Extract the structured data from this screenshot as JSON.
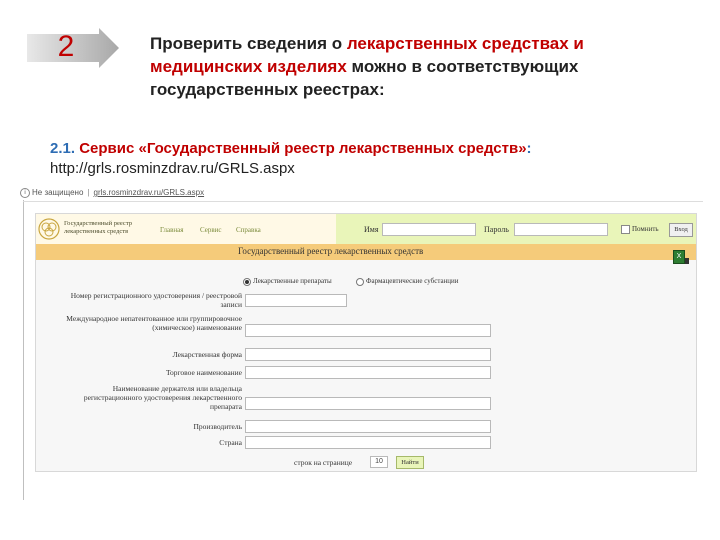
{
  "slide": {
    "step_number": "2",
    "headline_part1": "Проверить сведения о ",
    "headline_highlight": "лекарственных средствах и медицинских изделиях",
    "headline_part2": " можно в соответствующих государственных реестрах:",
    "service_number": "2.1.",
    "service_text": " Сервис «Государственный реестр лекарственных средств»",
    "service_colon": ":",
    "url": "http://grls.rosminzdrav.ru/GRLS.aspx"
  },
  "browser": {
    "security_label": "Не защищено",
    "address_url": "grls.rosminzdrav.ru/GRLS.aspx"
  },
  "site": {
    "logo_text": "Государственный реестр лекарственных средств",
    "nav": [
      "Главная",
      "Сервис",
      "Справка"
    ],
    "login_label": "Имя",
    "password_label": "Пароль",
    "remember_label": "Помнить",
    "login_button": "Вход",
    "title": "Государственный реестр лекарственных средств",
    "excel_icon": "excel-icon",
    "radio_options": [
      "Лекарственные препараты",
      "Фармацевтические субстанции"
    ],
    "fields": [
      "Номер регистрационного удостоверения / реестровой записи",
      "Международное непатентованное или группировочное (химическое) наименование",
      "Лекарственная форма",
      "Торговое наименование",
      "Наименование держателя или владельца регистрационного удостоверения лекарственного препарата",
      "Производитель",
      "Страна"
    ],
    "per_page_label": "строк на странице",
    "per_page_value": "10",
    "find_button": "Найти"
  },
  "colors": {
    "accent_red": "#c00000",
    "title_bar": "#f5cb7a",
    "header_green": "#e9f5b9",
    "header_cream": "#fff9e6"
  }
}
